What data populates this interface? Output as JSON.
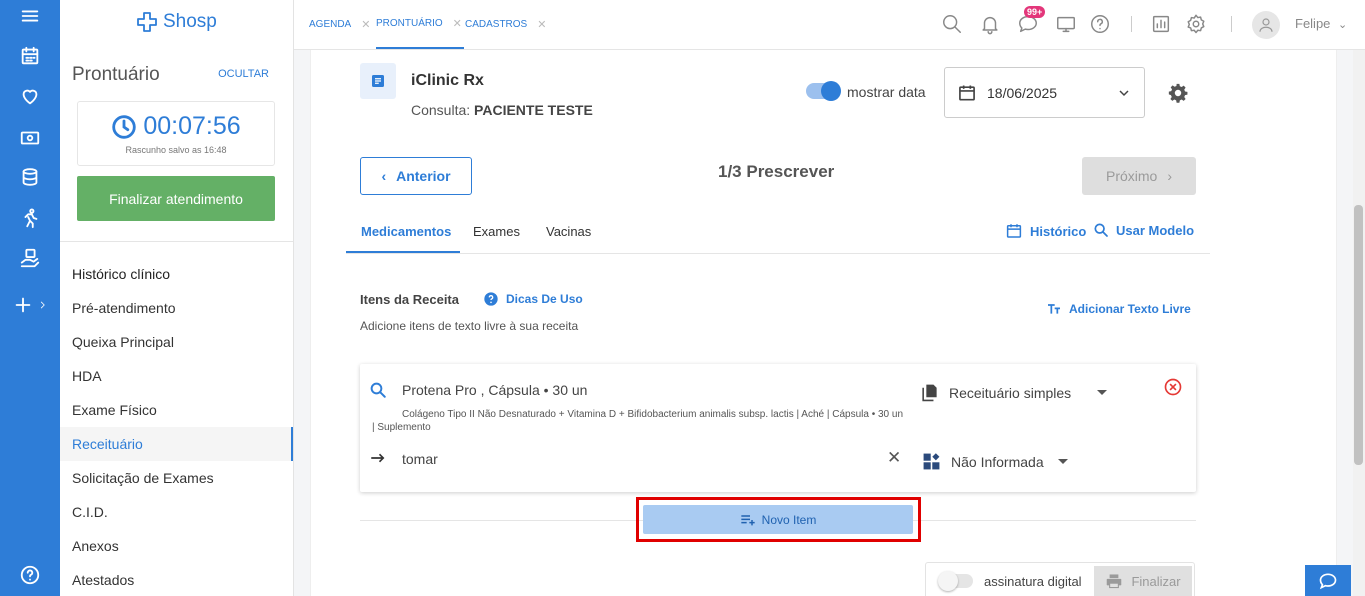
{
  "brand": {
    "name": "Shosp"
  },
  "rail": {
    "icons": [
      "menu-icon",
      "calendar-icon",
      "heart-icon",
      "money-icon",
      "database-icon",
      "running-icon",
      "care-icon",
      "plus-icon",
      "help-icon"
    ]
  },
  "panel": {
    "title": "Prontuário",
    "hide_label": "OCULTAR",
    "timer": "00:07:56",
    "draft_status": "Rascunho salvo as 16:48",
    "finish_label": "Finalizar atendimento",
    "nav": [
      {
        "label": "Histórico clínico"
      },
      {
        "label": "Pré-atendimento"
      },
      {
        "label": "Queixa Principal"
      },
      {
        "label": "HDA"
      },
      {
        "label": "Exame Físico"
      },
      {
        "label": "Receituário"
      },
      {
        "label": "Solicitação de Exames"
      },
      {
        "label": "C.I.D."
      },
      {
        "label": "Anexos"
      },
      {
        "label": "Atestados"
      }
    ],
    "active_nav": "Receituário"
  },
  "topbar": {
    "tabs": [
      {
        "label": "AGENDA"
      },
      {
        "label": "PRONTUÁRIO"
      },
      {
        "label": "CADASTROS"
      }
    ],
    "active_tab": "PRONTUÁRIO",
    "notification_badge": "99+",
    "user_name": "Felipe"
  },
  "prescription": {
    "title": "iClinic Rx",
    "consult_prefix": "Consulta:",
    "patient": "PACIENTE TESTE",
    "show_date_label": "mostrar data",
    "show_date_on": true,
    "date": "18/06/2025",
    "prev_label": "Anterior",
    "step": "1/3 Prescrever",
    "next_label": "Próximo",
    "subtabs": [
      {
        "label": "Medicamentos"
      },
      {
        "label": "Exames"
      },
      {
        "label": "Vacinas"
      }
    ],
    "active_subtab": "Medicamentos",
    "history_label": "Histórico",
    "use_model_label": "Usar Modelo",
    "items_title": "Itens da Receita",
    "tips_label": "Dicas De Uso",
    "items_sub": "Adicione itens de texto livre à sua receita",
    "add_free_text_label": "Adicionar Texto Livre",
    "item": {
      "name": "Protena Pro  , Cápsula • 30 un",
      "description": "Colágeno Tipo II Não Desnaturado + Vitamina D + Bifidobacterium animalis subsp. lactis | Aché | Cápsula • 30 un | Suplemento",
      "dose": "tomar",
      "prescription_type": "Receituário simples",
      "category": "Não Informada"
    },
    "new_item_label": "Novo Item",
    "digital_signature_label": "assinatura digital",
    "digital_signature_on": false,
    "finalize_label": "Finalizar"
  },
  "colors": {
    "primary": "#2e7dd7",
    "success": "#64b066",
    "danger": "#e53935",
    "highlight": "#e00000"
  }
}
